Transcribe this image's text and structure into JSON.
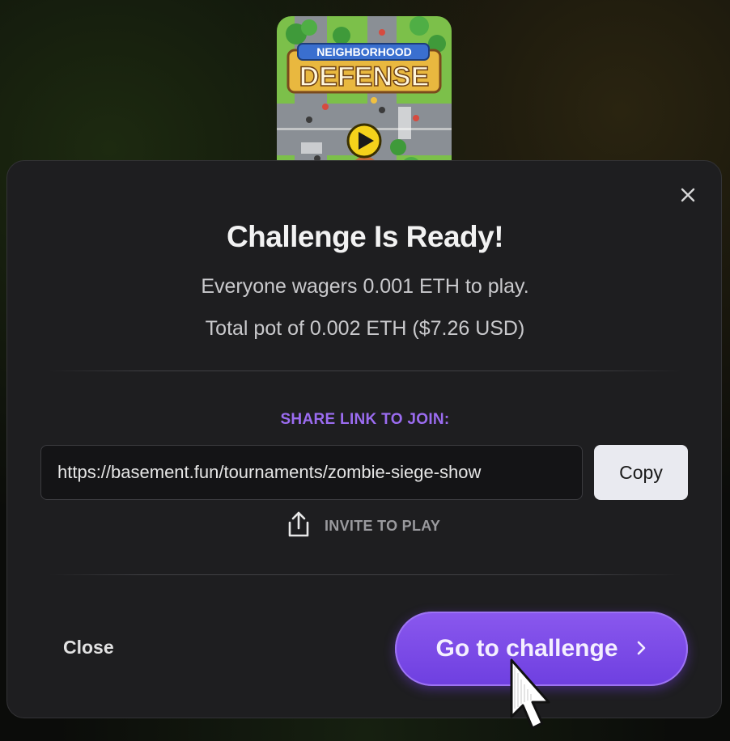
{
  "game": {
    "title_top": "NEIGHBORHOOD",
    "title_main": "DEFENSE",
    "thumbnail_icon": "play-icon"
  },
  "modal": {
    "close_icon": "close-icon",
    "title": "Challenge Is Ready!",
    "wager_text": "Everyone wagers 0.001 ETH to play.",
    "pot_text": "Total pot of 0.002 ETH ($7.26 USD)"
  },
  "share": {
    "label": "SHARE LINK TO JOIN:",
    "url": "https://basement.fun/tournaments/zombie-siege-show",
    "copy_label": "Copy",
    "invite_icon": "share-icon",
    "invite_label": "INVITE TO PLAY"
  },
  "footer": {
    "close_label": "Close",
    "go_label": "Go to challenge",
    "go_icon": "chevron-right-icon"
  },
  "colors": {
    "accent": "#7c4ce8",
    "share_label": "#9b6cf0",
    "modal_bg": "#1e1e20"
  }
}
